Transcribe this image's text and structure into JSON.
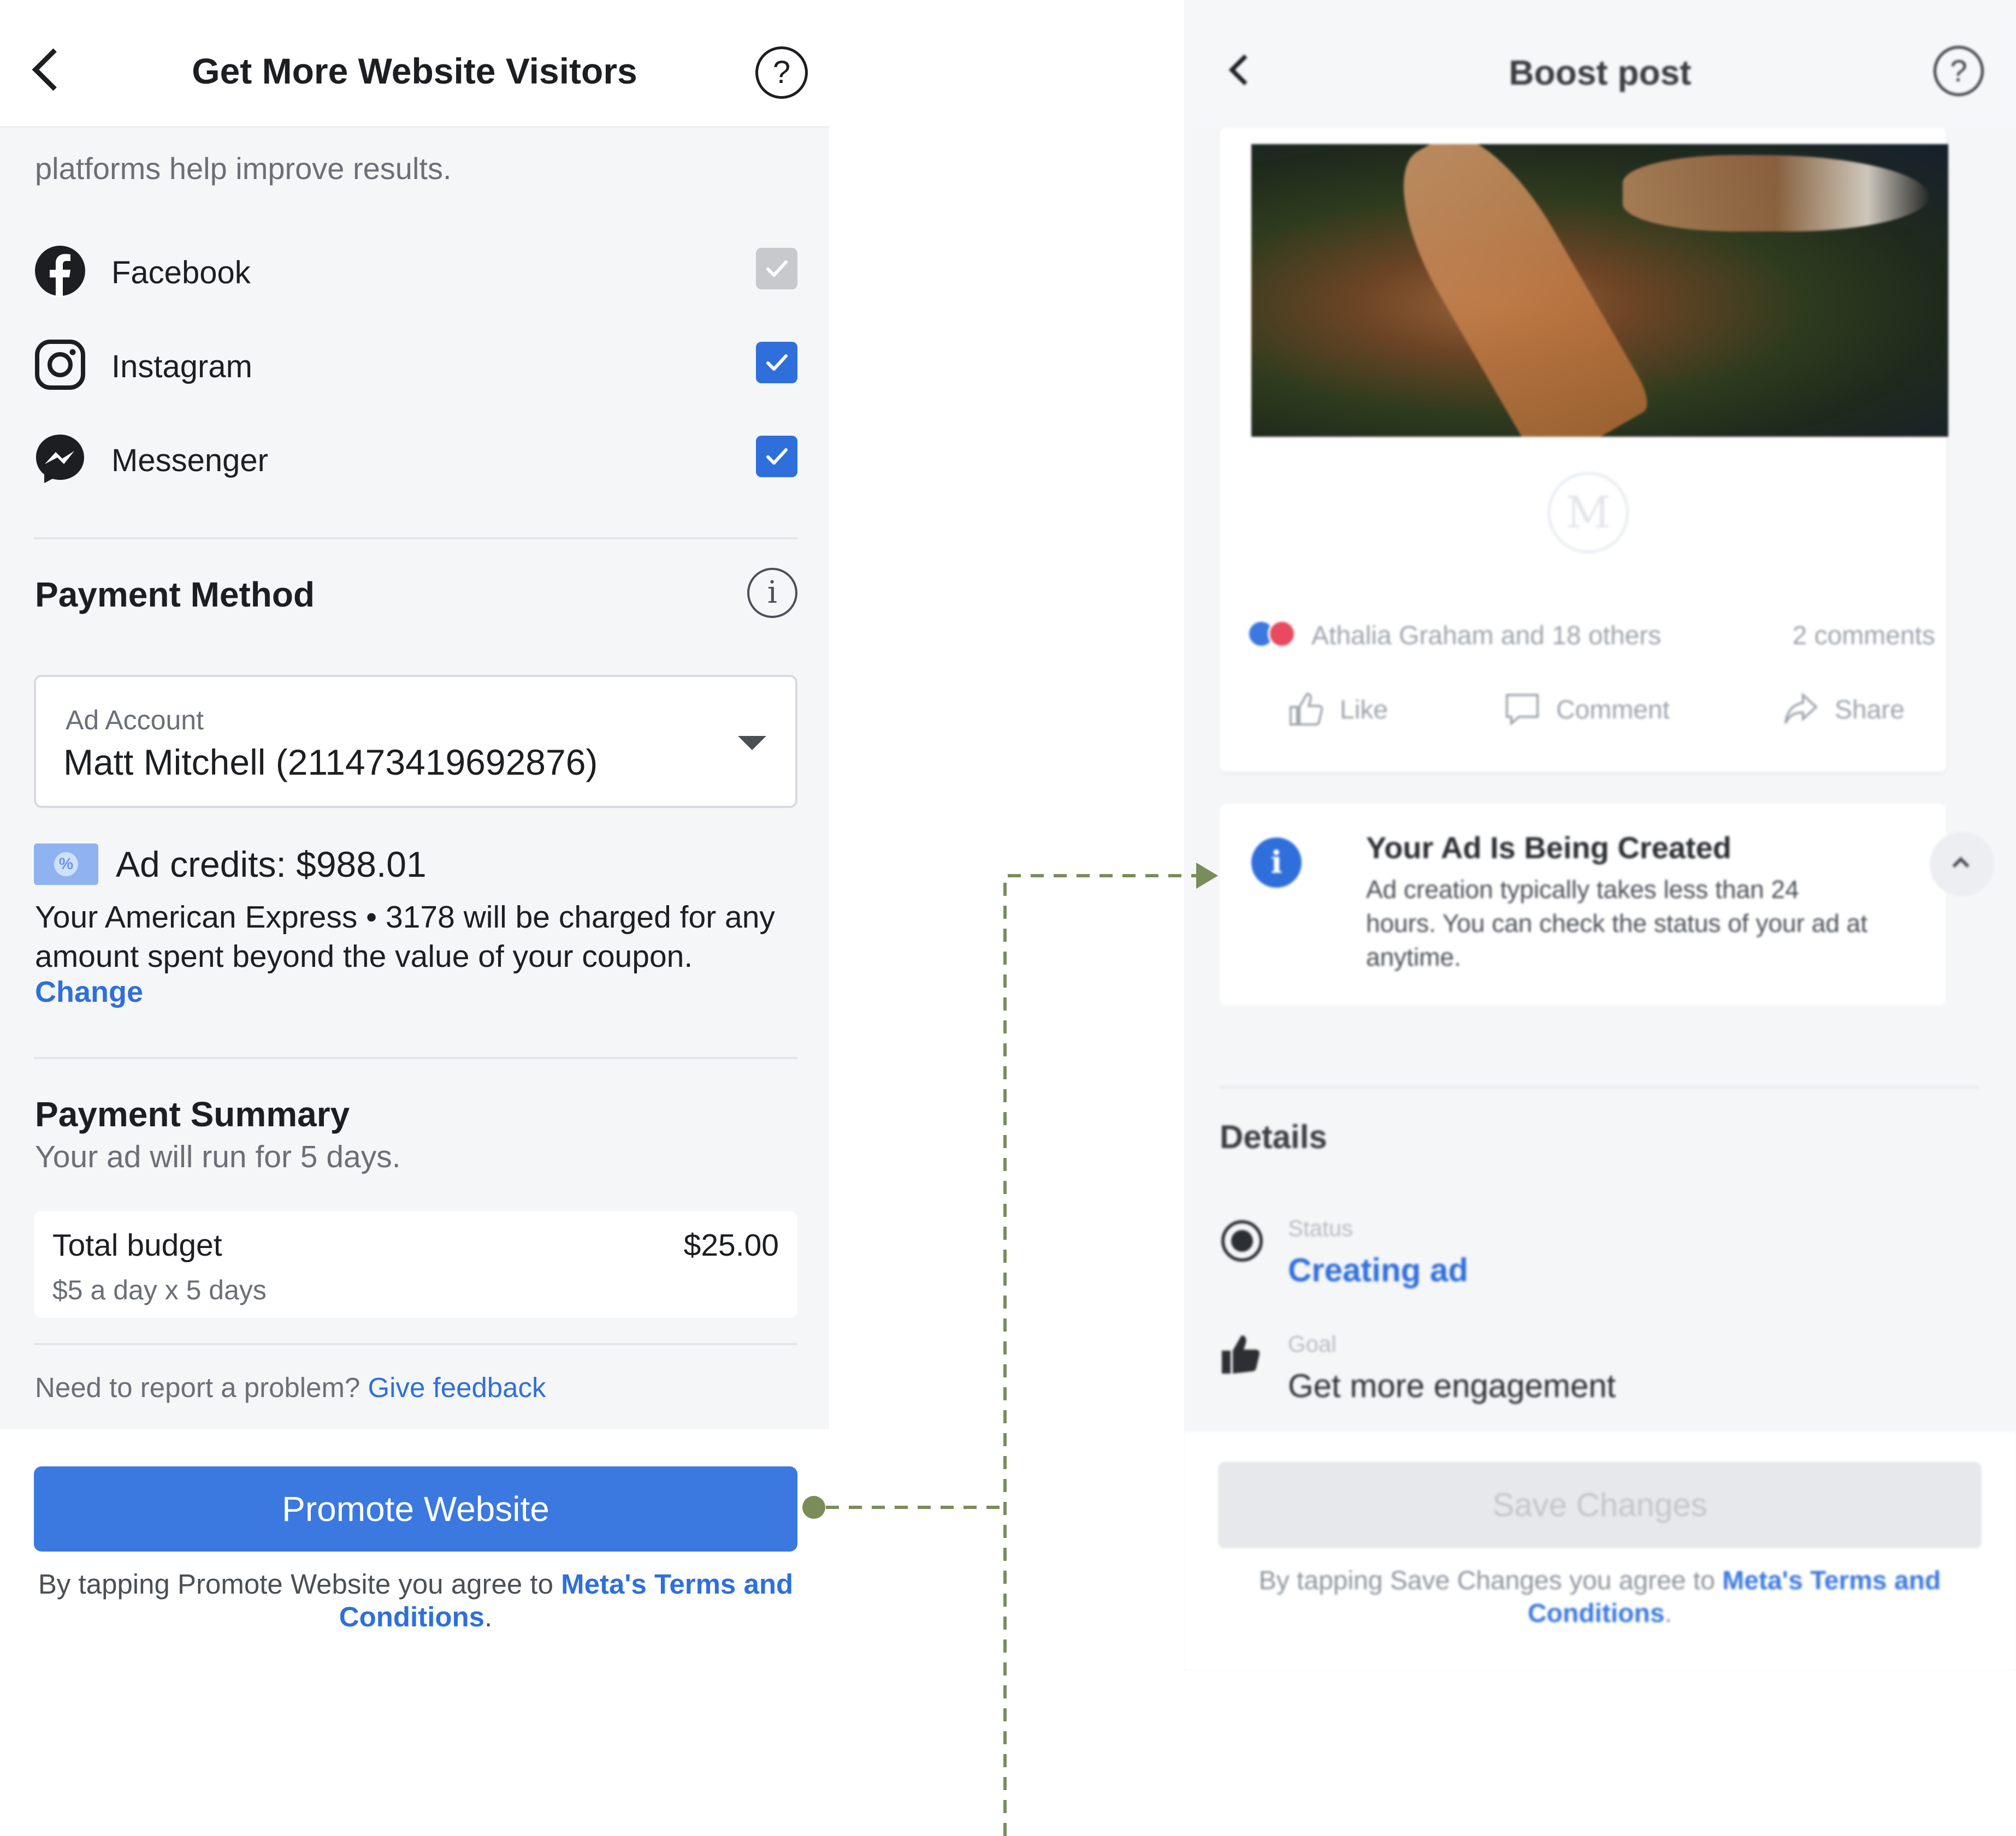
{
  "left_screen": {
    "header": {
      "title": "Get More Website Visitors",
      "help_glyph": "?"
    },
    "intro_cutoff": "platforms help improve results.",
    "platforms": [
      {
        "label": "Facebook",
        "icon": "facebook-icon",
        "checked": true,
        "disabled": true
      },
      {
        "label": "Instagram",
        "icon": "instagram-icon",
        "checked": true,
        "disabled": false
      },
      {
        "label": "Messenger",
        "icon": "messenger-icon",
        "checked": true,
        "disabled": false
      }
    ],
    "payment_method": {
      "heading": "Payment Method",
      "info_glyph": "i",
      "ad_account_label": "Ad Account",
      "ad_account_value": "Matt Mitchell (211473419692876)",
      "credits": "Ad credits: $988.01",
      "charge_text": "Your American Express • 3178 will be charged for any amount spent beyond the value of your coupon.",
      "change_link": "Change"
    },
    "payment_summary": {
      "heading": "Payment Summary",
      "subtitle": "Your ad will run for 5 days.",
      "budget_label": "Total budget",
      "budget_value": "$25.00",
      "budget_detail": "$5 a day x 5 days"
    },
    "feedback": {
      "text": "Need to report a problem?",
      "link": "Give feedback"
    },
    "primary_button": "Promote Website",
    "terms": {
      "prefix": "By tapping Promote Website you agree to",
      "link": "Meta's Terms and Conditions",
      "suffix": "."
    }
  },
  "right_screen": {
    "header": {
      "title": "Boost post",
      "help_glyph": "?"
    },
    "post": {
      "watermark": "M",
      "reactions_text": "Athalia Graham and 18 others",
      "comments_text": "2 comments",
      "actions": [
        "Like",
        "Comment",
        "Share"
      ]
    },
    "notice": {
      "icon_glyph": "i",
      "title": "Your Ad Is Being Created",
      "body": "Ad creation typically takes less than 24 hours. You can check the status of your ad at anytime."
    },
    "details": {
      "heading": "Details",
      "status_label": "Status",
      "status_value": "Creating ad",
      "goal_label": "Goal",
      "goal_value": "Get more engagement"
    },
    "button": "Save Changes",
    "terms": {
      "prefix": "By tapping Save Changes you agree to",
      "link": "Meta's Terms and Conditions",
      "suffix": "."
    }
  },
  "colors": {
    "primary_blue": "#3b78e0",
    "link_blue": "#2f6fdc",
    "connector_green": "#7a8c5a",
    "screen_bg": "#f5f6f8"
  }
}
